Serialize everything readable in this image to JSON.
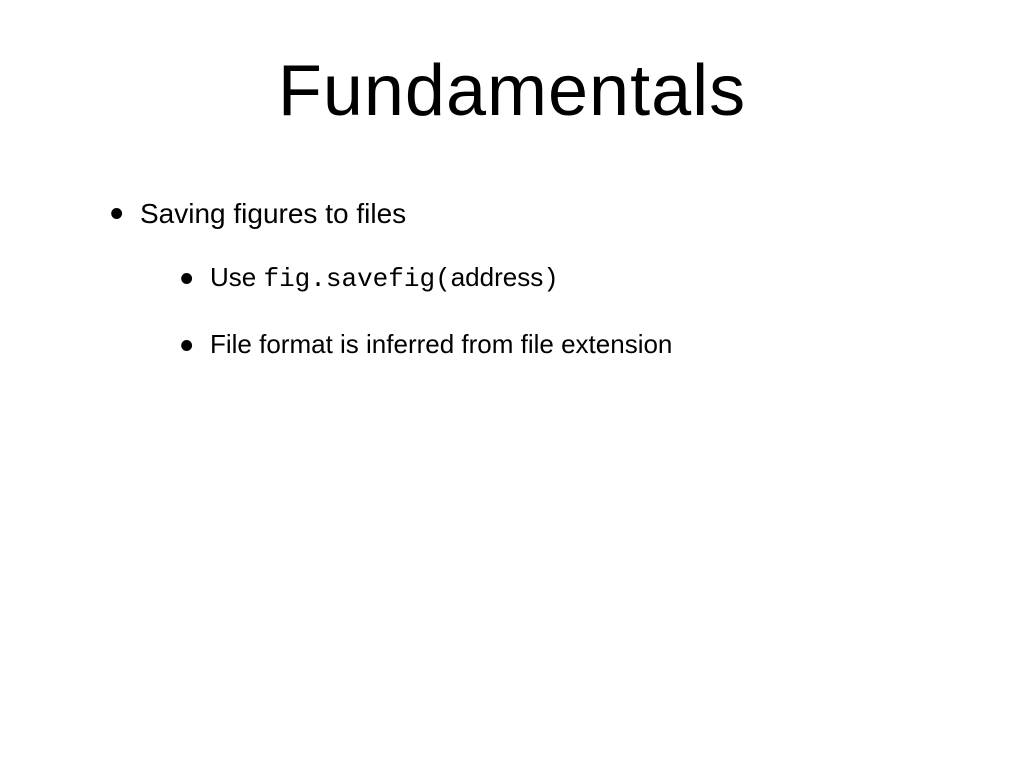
{
  "title": "Fundamentals",
  "bullets": {
    "item1": "Saving figures to files",
    "sub1_prefix": "Use ",
    "sub1_code1": "fig.savefig(",
    "sub1_arg": "address",
    "sub1_code2": ")",
    "sub2": "File format is inferred from file extension"
  }
}
